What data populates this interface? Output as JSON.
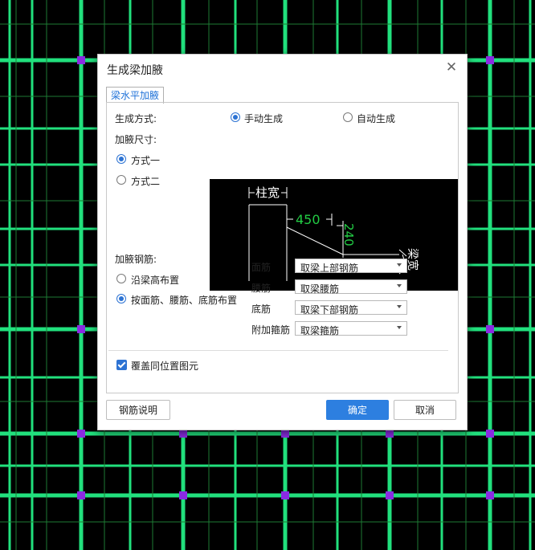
{
  "dialog": {
    "title": "生成梁加腋",
    "tab_label": "梁水平加腋",
    "gen_mode_label": "生成方式:",
    "gen_mode_manual": "手动生成",
    "gen_mode_auto": "自动生成",
    "size_label": "加腋尺寸:",
    "size_opt1": "方式一",
    "size_opt2": "方式二",
    "rebar_label": "加腋钢筋:",
    "rebar_opt1": "沿梁高布置",
    "rebar_opt2": "按面筋、腰筋、底筋布置",
    "rows": [
      {
        "label": "面筋",
        "value": "取梁上部钢筋"
      },
      {
        "label": "腰筋",
        "value": "取梁腰筋"
      },
      {
        "label": "底筋",
        "value": "取梁下部钢筋"
      },
      {
        "label": "附加箍筋",
        "value": "取梁箍筋"
      }
    ],
    "overwrite_label": "覆盖同位置图元",
    "btn_help": "钢筋说明",
    "btn_ok": "确定",
    "btn_cancel": "取消"
  },
  "diagram": {
    "col_width": "柱宽",
    "dim1": "450",
    "dim2": "240",
    "beam_width": "梁宽"
  },
  "colors": {
    "accent": "#2d73d3",
    "cad_green": "#22e07a",
    "cad_dim_green": "#22cc44"
  }
}
